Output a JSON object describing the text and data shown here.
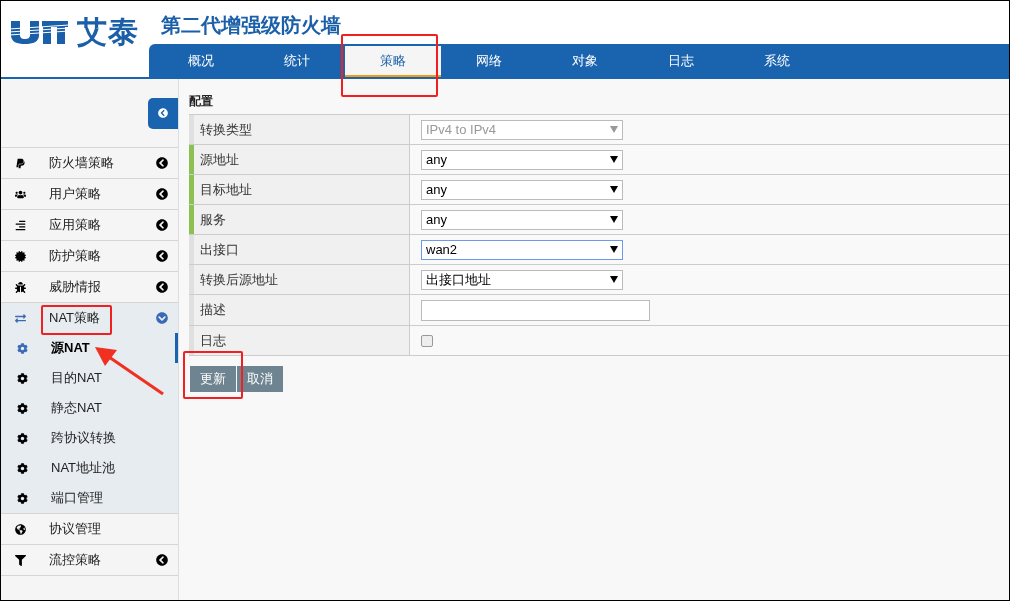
{
  "header": {
    "logo_text": "艾泰",
    "title": "第二代增强级防火墙"
  },
  "nav": [
    {
      "label": "概况",
      "selected": false
    },
    {
      "label": "统计",
      "selected": false
    },
    {
      "label": "策略",
      "selected": true
    },
    {
      "label": "网络",
      "selected": false
    },
    {
      "label": "对象",
      "selected": false
    },
    {
      "label": "日志",
      "selected": false
    },
    {
      "label": "系统",
      "selected": false
    }
  ],
  "sidebar": {
    "items": [
      {
        "label": "防火墙策略",
        "expandable": true,
        "expanded": false
      },
      {
        "label": "用户策略",
        "expandable": true,
        "expanded": false
      },
      {
        "label": "应用策略",
        "expandable": true,
        "expanded": false
      },
      {
        "label": "防护策略",
        "expandable": true,
        "expanded": false
      },
      {
        "label": "威胁情报",
        "expandable": true,
        "expanded": false
      },
      {
        "label": "NAT策略",
        "expandable": true,
        "expanded": true,
        "children": [
          {
            "label": "源NAT",
            "selected": true
          },
          {
            "label": "目的NAT",
            "selected": false
          },
          {
            "label": "静态NAT",
            "selected": false
          },
          {
            "label": "跨协议转换",
            "selected": false
          },
          {
            "label": "NAT地址池",
            "selected": false
          },
          {
            "label": "端口管理",
            "selected": false
          }
        ]
      },
      {
        "label": "协议管理",
        "expandable": false,
        "expanded": false
      },
      {
        "label": "流控策略",
        "expandable": true,
        "expanded": false
      }
    ]
  },
  "form": {
    "title": "配置",
    "rows": [
      {
        "label": "转换类型",
        "kind": "select",
        "value": "IPv4 to IPv4",
        "required": false,
        "disabled": true,
        "focused": false
      },
      {
        "label": "源地址",
        "kind": "select",
        "value": "any",
        "required": true,
        "disabled": false,
        "focused": false
      },
      {
        "label": "目标地址",
        "kind": "select",
        "value": "any",
        "required": true,
        "disabled": false,
        "focused": false
      },
      {
        "label": "服务",
        "kind": "select",
        "value": "any",
        "required": true,
        "disabled": false,
        "focused": false
      },
      {
        "label": "出接口",
        "kind": "select",
        "value": "wan2",
        "required": false,
        "disabled": false,
        "focused": true
      },
      {
        "label": "转换后源地址",
        "kind": "select",
        "value": "出接口地址",
        "required": false,
        "disabled": false,
        "focused": false
      },
      {
        "label": "描述",
        "kind": "text",
        "required": false
      },
      {
        "label": "日志",
        "kind": "checkbox",
        "checked": false,
        "required": false
      }
    ],
    "buttons": [
      "更新",
      "取消"
    ]
  }
}
